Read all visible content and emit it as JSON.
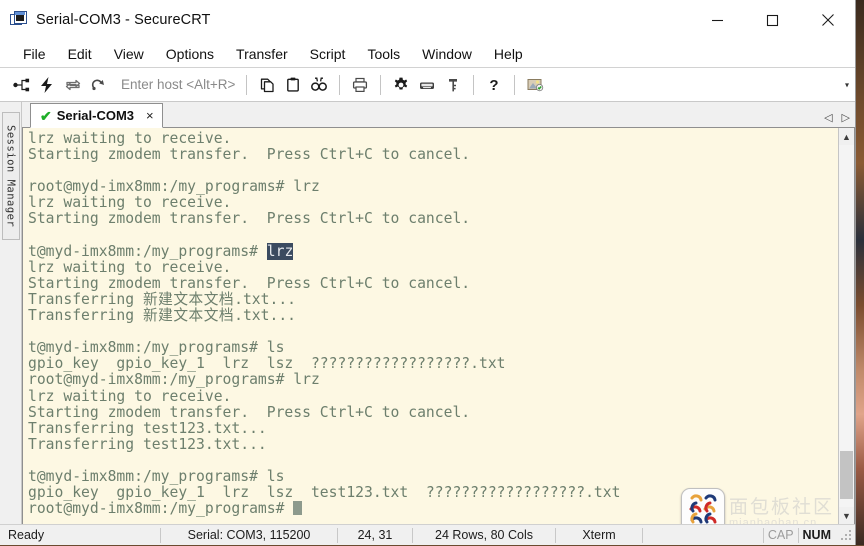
{
  "window": {
    "title": "Serial-COM3 - SecureCRT",
    "app_icon": "terminal-window-icon",
    "minimize_label": "Minimize",
    "maximize_label": "Maximize",
    "close_label": "Close"
  },
  "menubar": {
    "items": [
      {
        "label": "File"
      },
      {
        "label": "Edit"
      },
      {
        "label": "View"
      },
      {
        "label": "Options"
      },
      {
        "label": "Transfer"
      },
      {
        "label": "Script"
      },
      {
        "label": "Tools"
      },
      {
        "label": "Window"
      },
      {
        "label": "Help"
      }
    ]
  },
  "toolbar": {
    "host_entry_placeholder": "Enter host <Alt+R>",
    "overflow_label": "▾",
    "buttons": [
      {
        "name": "connect-icon",
        "title": "Connect"
      },
      {
        "name": "quick-connect-icon",
        "title": "Quick Connect"
      },
      {
        "name": "connect-in-tab-icon",
        "title": "Connect in Tab"
      },
      {
        "name": "reconnect-icon",
        "title": "Reconnect"
      },
      {
        "name": "copy-icon",
        "title": "Copy"
      },
      {
        "name": "paste-icon",
        "title": "Paste"
      },
      {
        "name": "find-icon",
        "title": "Find"
      },
      {
        "name": "print-icon",
        "title": "Print"
      },
      {
        "name": "gear-icon",
        "title": "Session Options"
      },
      {
        "name": "keyboard-icon",
        "title": "Keymap Editor"
      },
      {
        "name": "key-icon",
        "title": "Public Key"
      },
      {
        "name": "help-icon",
        "title": "Help"
      },
      {
        "name": "transfer-image-icon",
        "title": "Transfer"
      }
    ]
  },
  "sidebar": {
    "session_manager_label": "Session Manager"
  },
  "tabstrip": {
    "tabs": [
      {
        "label": "Serial-COM3",
        "status_icon": "check-icon",
        "close_label": "×"
      }
    ],
    "scroll_left": "◁",
    "scroll_right": "▷"
  },
  "terminal": {
    "colors": {
      "background": "#fdf8e3",
      "foreground": "#6d7f6d",
      "selection_background": "#3b4b60",
      "selection_foreground": "#e6e9ee"
    },
    "lines": [
      {
        "text": "lrz waiting to receive."
      },
      {
        "text": "Starting zmodem transfer.  Press Ctrl+C to cancel."
      },
      {
        "text": ""
      },
      {
        "text": "root@myd-imx8mm:/my_programs# lrz"
      },
      {
        "text": "lrz waiting to receive."
      },
      {
        "text": "Starting zmodem transfer.  Press Ctrl+C to cancel."
      },
      {
        "text": ""
      },
      {
        "text": "t@myd-imx8mm:/my_programs# ",
        "selected": "lrz"
      },
      {
        "text": "lrz waiting to receive."
      },
      {
        "text": "Starting zmodem transfer.  Press Ctrl+C to cancel."
      },
      {
        "text": "Transferring ",
        "cjk": "新建文本文档",
        "tail": ".txt..."
      },
      {
        "text": "Transferring ",
        "cjk": "新建文本文档",
        "tail": ".txt..."
      },
      {
        "text": ""
      },
      {
        "text": "t@myd-imx8mm:/my_programs# ls"
      },
      {
        "text": "gpio_key  gpio_key_1  lrz  lsz  ??????????????????.txt"
      },
      {
        "text": "root@myd-imx8mm:/my_programs# lrz"
      },
      {
        "text": "lrz waiting to receive."
      },
      {
        "text": "Starting zmodem transfer.  Press Ctrl+C to cancel."
      },
      {
        "text": "Transferring test123.txt..."
      },
      {
        "text": "Transferring test123.txt..."
      },
      {
        "text": ""
      },
      {
        "text": "t@myd-imx8mm:/my_programs# ls"
      },
      {
        "text": "gpio_key  gpio_key_1  lrz  lsz  test123.txt  ??????????????????.txt"
      },
      {
        "text": "root@myd-imx8mm:/my_programs# ",
        "cursor": true
      }
    ]
  },
  "watermark": {
    "cn_text": "面包板社区",
    "en_text": "mianbaoban.cn",
    "logo_name": "mianbaoban-logo"
  },
  "statusbar": {
    "ready": "Ready",
    "serial": "Serial: COM3, 115200",
    "coords": "24,  31",
    "rows_cols": "24 Rows, 80 Cols",
    "emulation": "Xterm",
    "cap": "CAP",
    "num": "NUM"
  }
}
